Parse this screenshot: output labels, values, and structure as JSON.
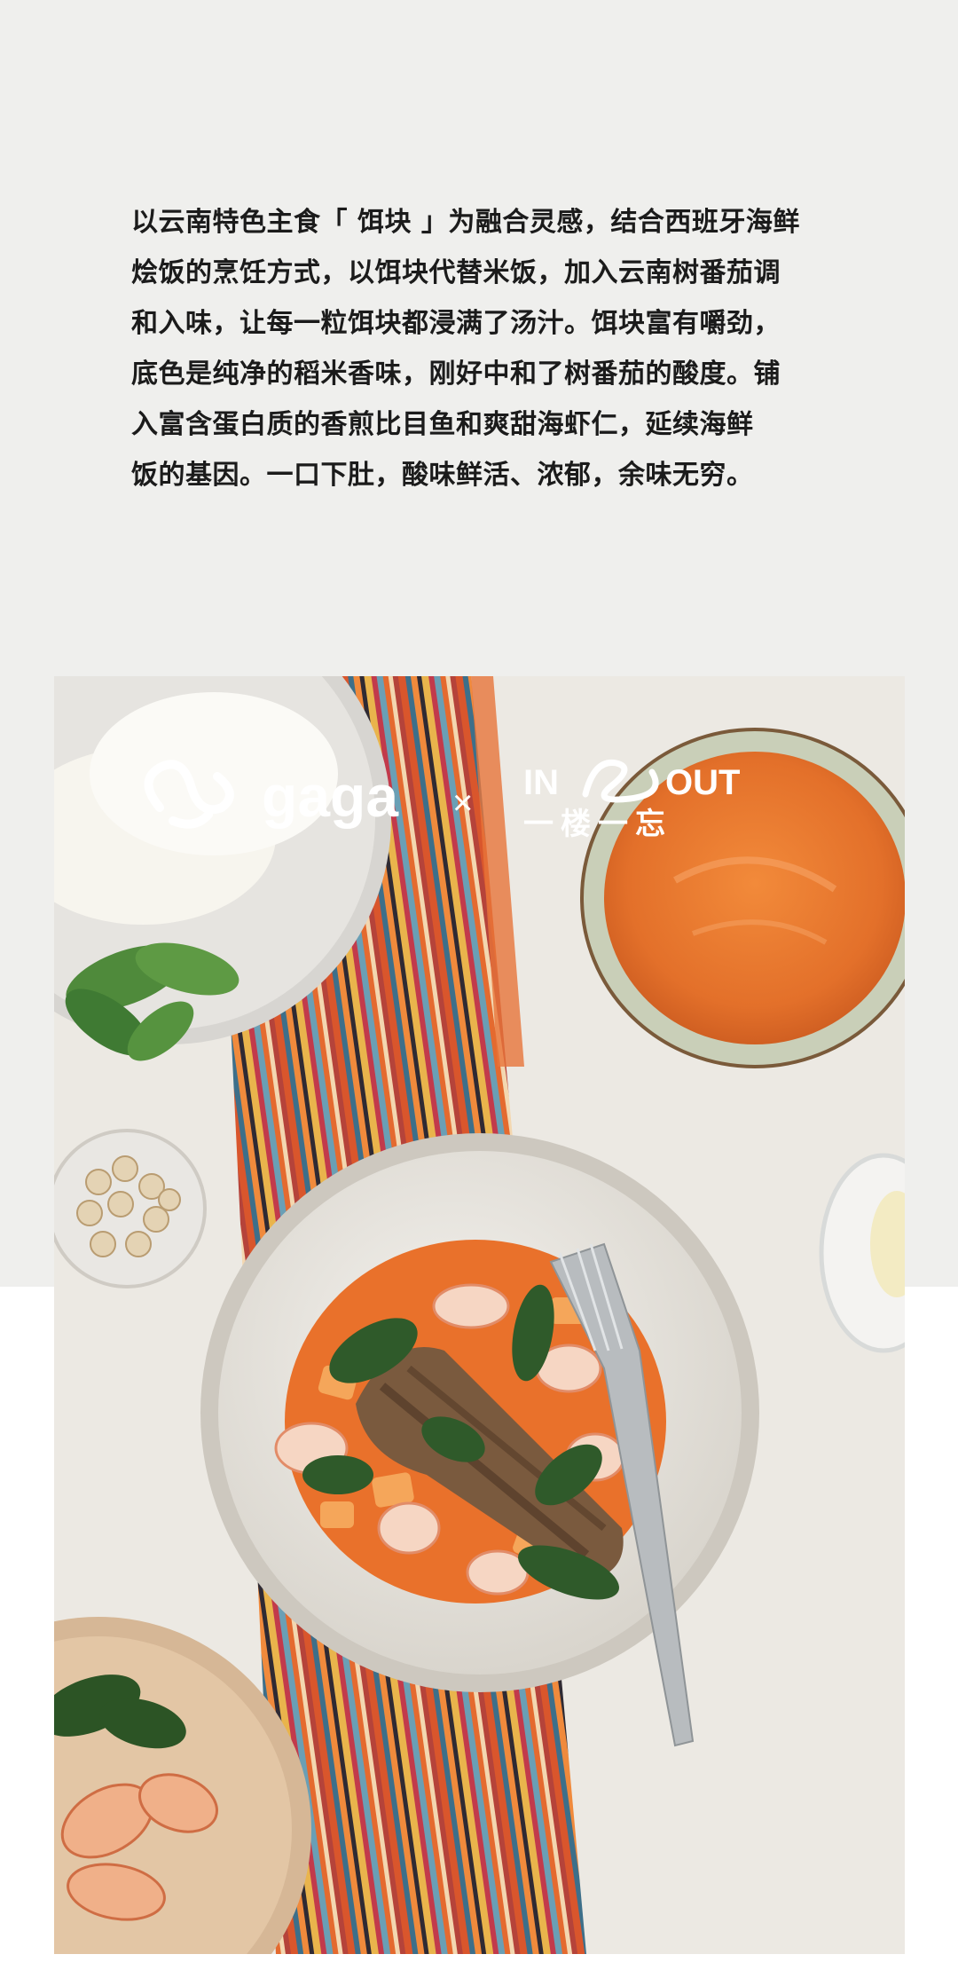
{
  "description": {
    "lines": [
      "以云南特色主食「 饵块 」为融合灵感，结合西班牙海鲜",
      "烩饭的烹饪方式，以饵块代替米饭，加入云南树番茄调",
      "和入味，让每一粒饵块都浸满了汤汁。饵块富有嚼劲，",
      "底色是纯净的稻米香味，刚好中和了树番茄的酸度。铺",
      "入富含蛋白质的香煎比目鱼和爽甜海虾仁，延续海鲜",
      "饭的基因。一口下肚，酸味鲜活、浓郁，余味无穷。"
    ]
  },
  "brands": {
    "left": "gaga",
    "separator": "×",
    "right_top_left": "IN",
    "right_top_right": "OUT",
    "right_bottom": "一楼一忘"
  },
  "photo": {
    "subject": "seafood-eba-paella-flatlay"
  },
  "colors": {
    "page_top": "#efefed",
    "text": "#1b1b1b",
    "tomato_sauce": "#e9782c",
    "tablecloth": "#ece9e3"
  }
}
